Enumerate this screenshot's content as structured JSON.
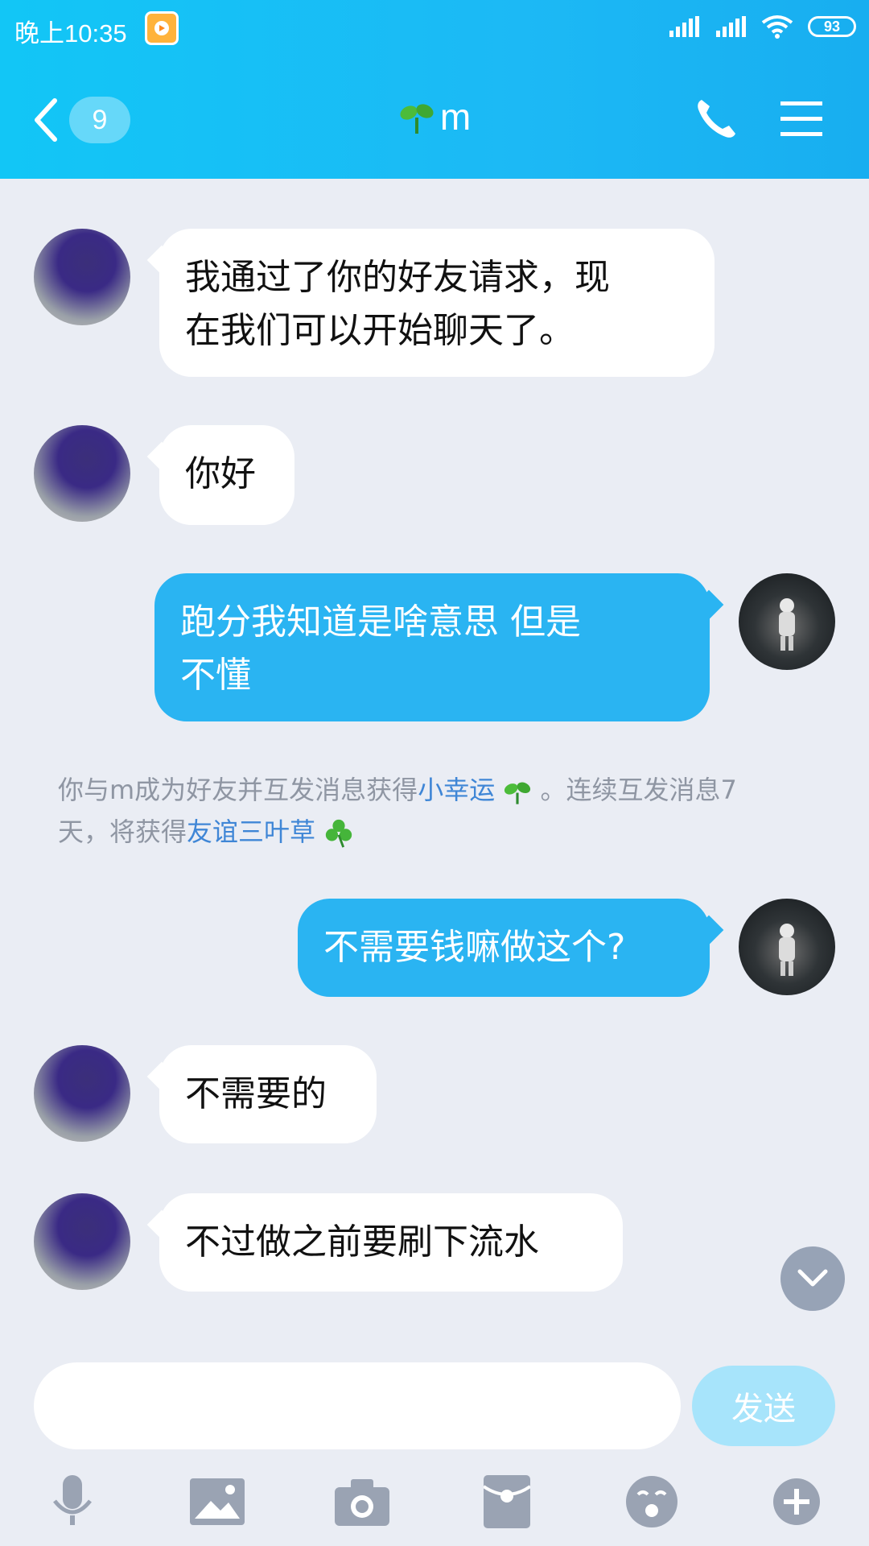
{
  "status_bar": {
    "time": "晚上10:35",
    "battery": "93"
  },
  "header": {
    "unread_count": "9",
    "title": "m"
  },
  "messages": [
    {
      "from": "friend",
      "text_line1": "我通过了你的好友请求，现",
      "text_line2": "在我们可以开始聊天了。"
    },
    {
      "from": "friend",
      "text": "你好"
    },
    {
      "from": "me",
      "text_line1": "跑分我知道是啥意思  但是",
      "text_line2": "不懂"
    },
    {
      "from": "me",
      "text": "不需要钱嘛做这个?"
    },
    {
      "from": "friend",
      "text": "不需要的"
    },
    {
      "from": "friend",
      "text": "不过做之前要刷下流水"
    }
  ],
  "system_note": {
    "part1": "你与m成为好友并互发消息获得",
    "link1": "小幸运",
    "part2": "。连续互发消息7",
    "part3": "天，将获得",
    "link2": "友谊三叶草"
  },
  "input": {
    "placeholder": "",
    "send_label": "发送"
  },
  "icons": [
    "back-chevron-icon",
    "sprout-icon",
    "phone-icon",
    "menu-icon",
    "chevron-down-icon",
    "microphone-icon",
    "image-icon",
    "camera-icon",
    "red-packet-icon",
    "emoji-icon",
    "plus-icon"
  ],
  "colors": {
    "header": "#1cb9f5",
    "outgoing_bubble": "#2ab4f2",
    "incoming_bubble": "#ffffff",
    "background": "#eaedf4",
    "link": "#3f86d6"
  }
}
